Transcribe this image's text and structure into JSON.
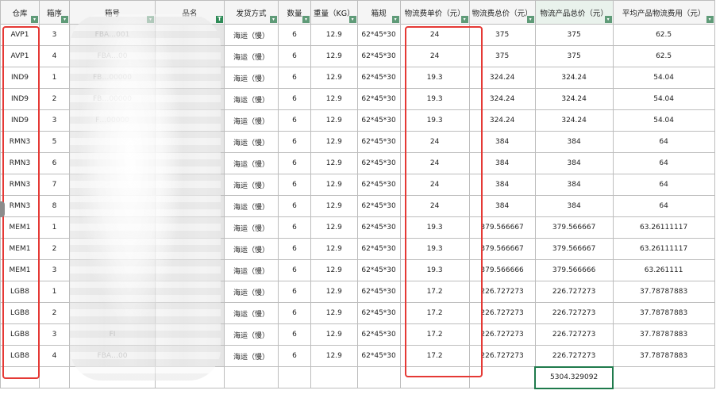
{
  "sheet": {
    "headers": [
      "仓库",
      "箱序",
      "箱号",
      "品名",
      "发货方式",
      "数量",
      "重量（KG）",
      "箱规",
      "物流费单价（元）",
      "物流费总价（元）",
      "物流产品总价（元）",
      "平均产品物流费用（元）"
    ],
    "filter_glyph": "▾",
    "text_filter_glyph": "T",
    "rows": [
      [
        "AVP1",
        "3",
        "FBA…001",
        "",
        "海运（慢）",
        "6",
        "12.9",
        "62*45*30",
        "24",
        "375",
        "375",
        "62.5"
      ],
      [
        "AVP1",
        "4",
        "FBA…00",
        "",
        "海运（慢）",
        "6",
        "12.9",
        "62*45*30",
        "24",
        "375",
        "375",
        "62.5"
      ],
      [
        "IND9",
        "1",
        "FB…00000",
        "",
        "海运（慢）",
        "6",
        "12.9",
        "62*45*30",
        "19.3",
        "324.24",
        "324.24",
        "54.04"
      ],
      [
        "IND9",
        "2",
        "FB…00000",
        "",
        "海运（慢）",
        "6",
        "12.9",
        "62*45*30",
        "19.3",
        "324.24",
        "324.24",
        "54.04"
      ],
      [
        "IND9",
        "3",
        "F…00000",
        "",
        "海运（慢）",
        "6",
        "12.9",
        "62*45*30",
        "19.3",
        "324.24",
        "324.24",
        "54.04"
      ],
      [
        "RMN3",
        "5",
        "",
        "",
        "海运（慢）",
        "6",
        "12.9",
        "62*45*30",
        "24",
        "384",
        "384",
        "64"
      ],
      [
        "RMN3",
        "6",
        "",
        "",
        "海运（慢）",
        "6",
        "12.9",
        "62*45*30",
        "24",
        "384",
        "384",
        "64"
      ],
      [
        "RMN3",
        "7",
        "",
        "",
        "海运（慢）",
        "6",
        "12.9",
        "62*45*30",
        "24",
        "384",
        "384",
        "64"
      ],
      [
        "RMN3",
        "8",
        "",
        "",
        "海运（慢）",
        "6",
        "12.9",
        "62*45*30",
        "24",
        "384",
        "384",
        "64"
      ],
      [
        "MEM1",
        "1",
        "",
        "",
        "海运（慢）",
        "6",
        "12.9",
        "62*45*30",
        "19.3",
        "379.566667",
        "379.566667",
        "63.26111117"
      ],
      [
        "MEM1",
        "2",
        "",
        "",
        "海运（慢）",
        "6",
        "12.9",
        "62*45*30",
        "19.3",
        "379.566667",
        "379.566667",
        "63.26111117"
      ],
      [
        "MEM1",
        "3",
        "",
        "",
        "海运（慢）",
        "6",
        "12.9",
        "62*45*30",
        "19.3",
        "379.566666",
        "379.566666",
        "63.261111"
      ],
      [
        "LGB8",
        "1",
        "",
        "",
        "海运（慢）",
        "6",
        "12.9",
        "62*45*30",
        "17.2",
        "226.727273",
        "226.727273",
        "37.78787883"
      ],
      [
        "LGB8",
        "2",
        "",
        "",
        "海运（慢）",
        "6",
        "12.9",
        "62*45*30",
        "17.2",
        "226.727273",
        "226.727273",
        "37.78787883"
      ],
      [
        "LGB8",
        "3",
        "FI",
        "",
        "海运（慢）",
        "6",
        "12.9",
        "62*45*30",
        "17.2",
        "226.727273",
        "226.727273",
        "37.78787883"
      ],
      [
        "LGB8",
        "4",
        "FBA…00",
        "",
        "海运（慢）",
        "6",
        "12.9",
        "62*45*30",
        "17.2",
        "226.727273",
        "226.727273",
        "37.78787883"
      ]
    ],
    "total_value": "5304.329092"
  },
  "colors": {
    "highlight_border": "#e53935",
    "selected_cell_border": "#1f7a4c",
    "filter_button": "#5f9b78"
  }
}
